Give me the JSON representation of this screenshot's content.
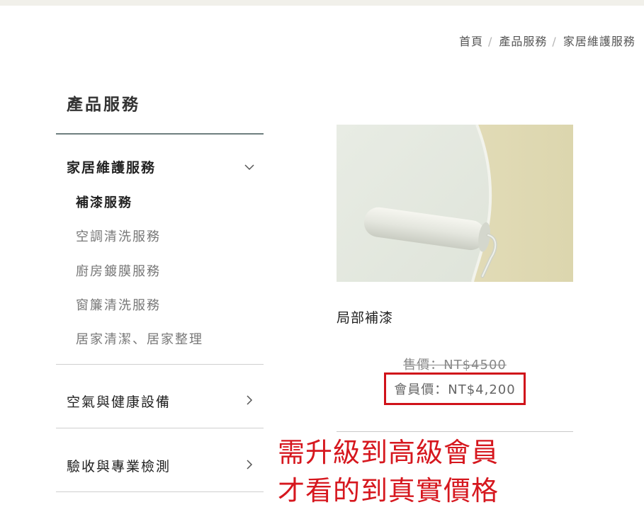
{
  "breadcrumb": {
    "items": [
      "首頁",
      "產品服務",
      "家居維護服務"
    ],
    "separator": "/"
  },
  "sidebar": {
    "title": "產品服務",
    "categories": [
      {
        "label": "家居維護服務",
        "expanded": true,
        "items": [
          {
            "label": "補漆服務",
            "active": true
          },
          {
            "label": "空調清洗服務",
            "active": false
          },
          {
            "label": "廚房鍍膜服務",
            "active": false
          },
          {
            "label": "窗簾清洗服務",
            "active": false
          },
          {
            "label": "居家清潔、居家整理",
            "active": false
          }
        ]
      },
      {
        "label": "空氣與健康設備",
        "expanded": false
      },
      {
        "label": "驗收與專業檢測",
        "expanded": false
      }
    ]
  },
  "product": {
    "name": "局部補漆",
    "price_label": "售價：NT$4500",
    "member_price_label": "會員價：NT$4,200",
    "image_icon": "paint-roller-image"
  },
  "annotation": {
    "line1": "需升級到高級會員",
    "line2": "才看的到真實價格",
    "color": "#d6171e"
  },
  "colors": {
    "top_bar": "#f1f0ea",
    "sidebar_rule": "#6f7f7f",
    "highlight_border": "#d0121a"
  }
}
